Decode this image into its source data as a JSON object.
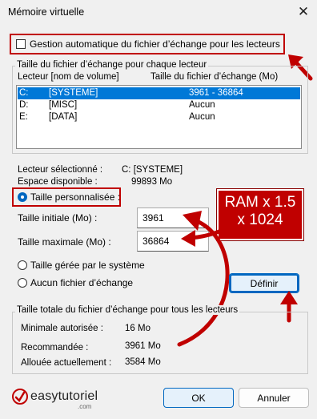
{
  "window": {
    "title": "Mémoire virtuelle",
    "close_icon": "close-icon"
  },
  "auto_manage": {
    "label": "Gestion automatique du fichier d’échange pour les lecteurs",
    "checked": false
  },
  "per_drive": {
    "group_title": "Taille du fichier d’échange pour chaque lecteur",
    "columns": [
      "Lecteur  [nom de volume]",
      "Taille du fichier d’échange (Mo)"
    ],
    "rows": [
      {
        "drive": "C:",
        "volume": "[SYSTEME]",
        "size": "3961 - 36864",
        "selected": true
      },
      {
        "drive": "D:",
        "volume": "[MISC]",
        "size": "Aucun",
        "selected": false
      },
      {
        "drive": "E:",
        "volume": "[DATA]",
        "size": "Aucun",
        "selected": false
      }
    ]
  },
  "selected_drive": {
    "label": "Lecteur sélectionné :",
    "value": "C:  [SYSTEME]",
    "space_label": "Espace disponible :",
    "space_value": "99893 Mo"
  },
  "custom_size": {
    "radio_label": "Taille personnalisée :",
    "initial_label": "Taille initiale (Mo) :",
    "initial_value": "3961",
    "max_label": "Taille maximale (Mo) :",
    "max_value": "36864"
  },
  "system_managed": {
    "label": "Taille gérée par le système"
  },
  "no_paging": {
    "label": "Aucun fichier d’échange"
  },
  "set_button": "Définir",
  "annotation": {
    "line1": "RAM x 1.5",
    "line2": "x 1024"
  },
  "totals": {
    "group_title": "Taille totale du fichier d’échange pour tous les lecteurs",
    "min_label": "Minimale autorisée :",
    "min_value": "16 Mo",
    "rec_label": "Recommandée :",
    "rec_value": "3961 Mo",
    "alloc_label": "Allouée actuellement :",
    "alloc_value": "3584 Mo"
  },
  "footer": {
    "ok": "OK",
    "cancel": "Annuler",
    "logo": "easytutoriel",
    "logo_sub": ".com"
  },
  "colors": {
    "accent": "#0078d7",
    "annotation": "#c00000"
  }
}
